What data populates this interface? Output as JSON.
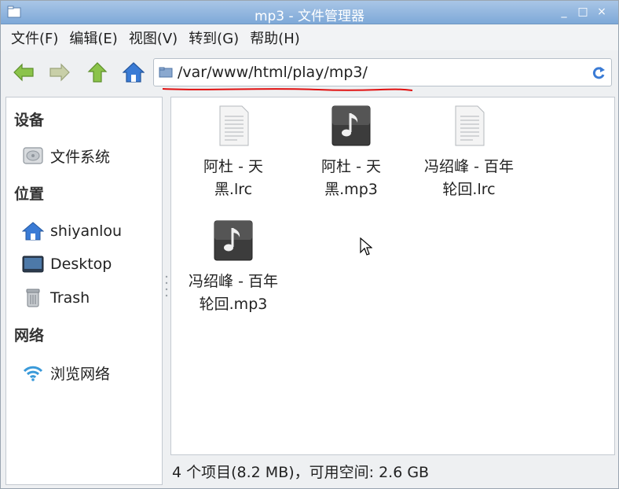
{
  "window": {
    "title": "mp3 - 文件管理器",
    "controls": [
      "_",
      "□",
      "×"
    ]
  },
  "menubar": {
    "items": [
      "文件(F)",
      "编辑(E)",
      "视图(V)",
      "转到(G)",
      "帮助(H)"
    ]
  },
  "toolbar": {
    "buttons": [
      "back-icon",
      "forward-icon",
      "up-icon",
      "home-icon"
    ],
    "path": "/var/www/html/play/mp3/",
    "refresh_icon": "refresh-icon"
  },
  "sidepane": {
    "devices_header": "设备",
    "devices": [
      {
        "label": "文件系统",
        "icon": "drive-icon"
      }
    ],
    "places_header": "位置",
    "places": [
      {
        "label": "shiyanlou",
        "icon": "home-icon"
      },
      {
        "label": "Desktop",
        "icon": "desktop-icon"
      },
      {
        "label": "Trash",
        "icon": "trash-icon"
      }
    ],
    "network_header": "网络",
    "network": [
      {
        "label": "浏览网络",
        "icon": "wifi-icon"
      }
    ]
  },
  "files": [
    {
      "line1": "阿杜 - 天",
      "line2": "黑.lrc",
      "type": "text-file-icon"
    },
    {
      "line1": "阿杜 - 天",
      "line2": "黑.mp3",
      "type": "music-file-icon"
    },
    {
      "line1": "冯绍峰 - 百年",
      "line2": "轮回.lrc",
      "type": "text-file-icon"
    },
    {
      "line1": "冯绍峰 - 百年",
      "line2": "轮回.mp3",
      "type": "music-file-icon"
    }
  ],
  "status": "4 个项目(8.2 MB)，可用空间: 2.6 GB",
  "colors": {
    "titlebar": "#8cb3de",
    "annotation": "#e01010",
    "folder_blue": "#3a7bd5",
    "nav_green": "#8bc34a"
  }
}
